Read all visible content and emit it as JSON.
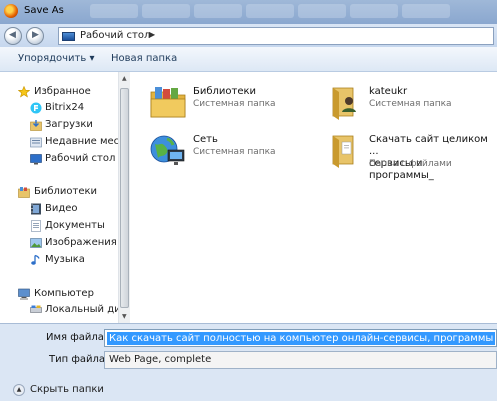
{
  "window": {
    "title": "Save As"
  },
  "address": {
    "crumb": "Рабочий стол"
  },
  "toolbar": {
    "organize": "Упорядочить ▾",
    "new_folder": "Новая папка"
  },
  "nav": {
    "favorites": "Избранное",
    "bitrix": "Bitrix24",
    "downloads": "Загрузки",
    "recent": "Недавние места",
    "desktop": "Рабочий стол",
    "libraries": "Библиотеки",
    "video": "Видео",
    "documents": "Документы",
    "images": "Изображения",
    "music": "Музыка",
    "computer": "Компьютер",
    "local_disk": "Локальный диск"
  },
  "items": [
    {
      "name": "Библиотеки",
      "sub": "Системная папка"
    },
    {
      "name": "kateukr",
      "sub": "Системная папка"
    },
    {
      "name": "Сеть",
      "sub": "Системная папка"
    },
    {
      "name": "Скачать сайт целиком ...",
      "name2": "сервисы и программы_",
      "sub": "Папка с файлами"
    }
  ],
  "form": {
    "filename_label": "Имя файла:",
    "filename_value": "Как скачать сайт полностью на компьютер  онлайн-сервисы, программы",
    "filetype_label": "Тип файла:",
    "filetype_value": "Web Page, complete"
  },
  "hide_folders": "Скрыть папки"
}
